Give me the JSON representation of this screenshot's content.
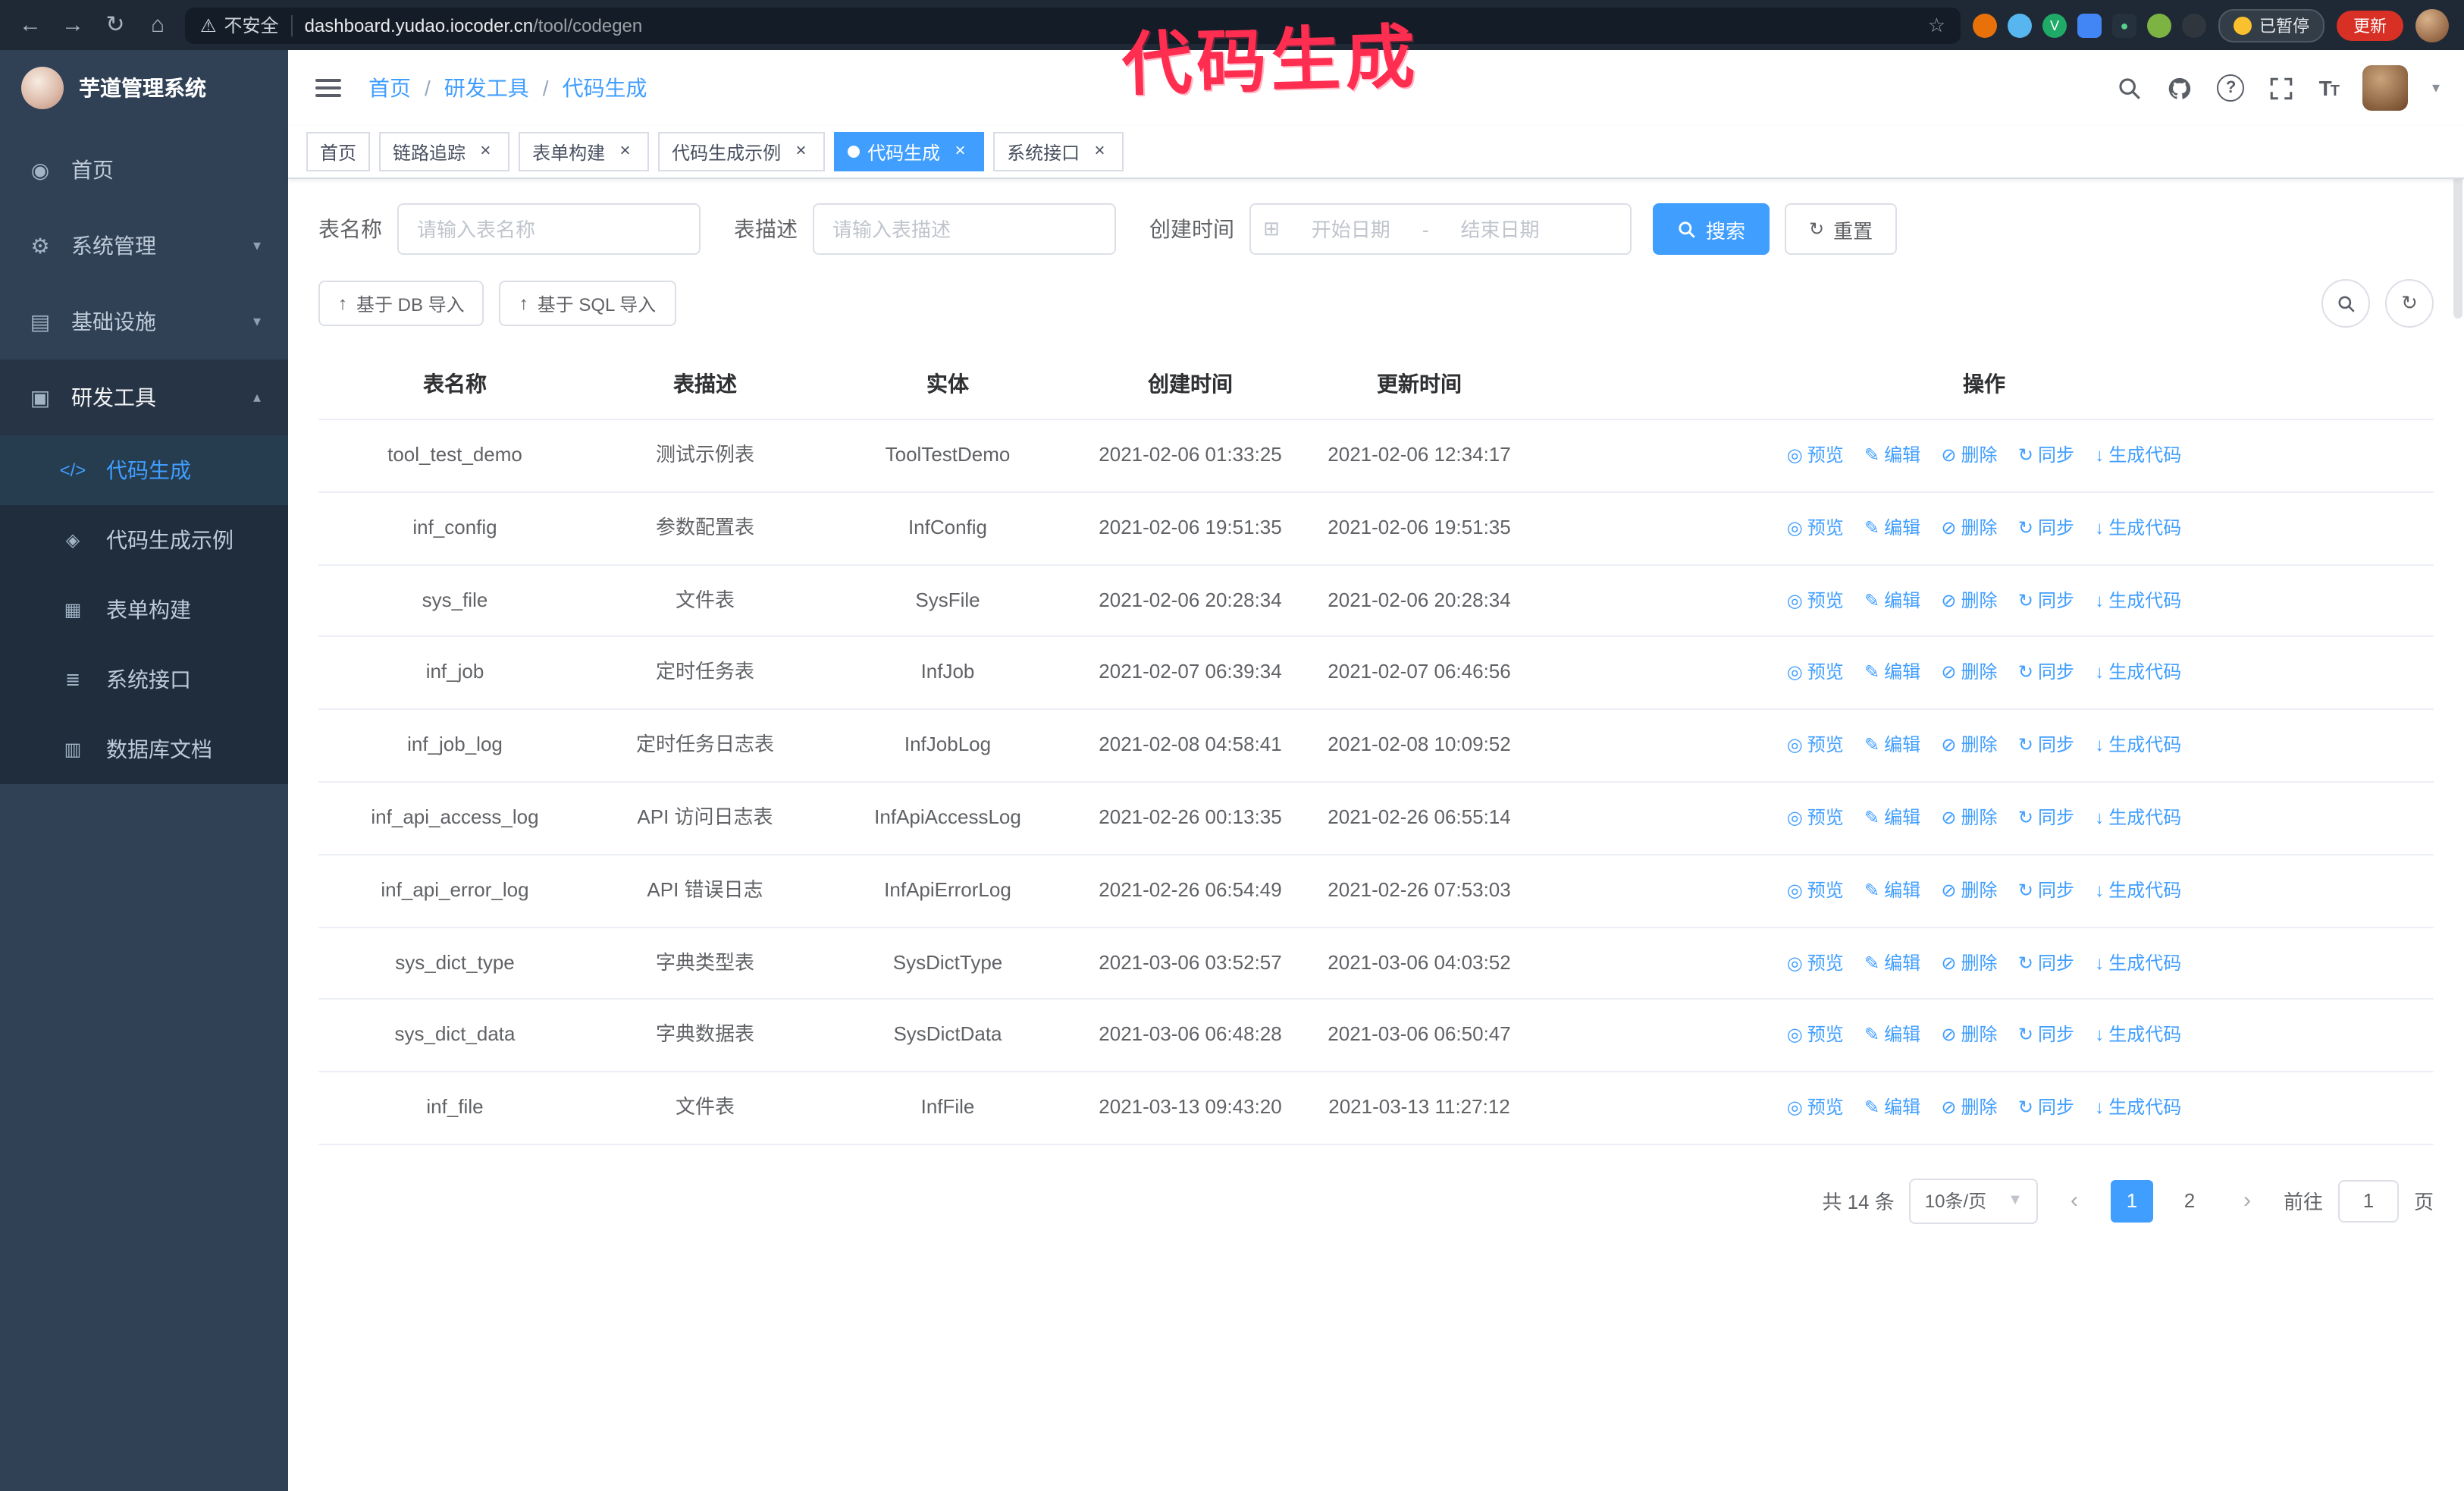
{
  "browser": {
    "security_label": "不安全",
    "url_host": "dashboard.yudao.iocoder.cn",
    "url_path": "/tool/codegen",
    "paused_label": "已暂停",
    "update_label": "更新"
  },
  "annotation": {
    "text": "代码生成",
    "color": "#ff2d4f"
  },
  "icons": {
    "back": "←",
    "forward": "→",
    "reload": "↻",
    "home": "⌂",
    "warning": "⚠",
    "star": "☆",
    "caret_down": "▾",
    "caret_up": "▴",
    "upload": "↑",
    "calendar": "⊞",
    "eye": "◎",
    "edit": "✎",
    "trash": "⊘",
    "sync": "↻",
    "download": "↓",
    "close": "×",
    "prev": "‹",
    "next": "›",
    "select_caret": "▼"
  },
  "sidebar": {
    "logo_title": "芋道管理系统",
    "items": [
      {
        "label": "首页",
        "icon": "◉"
      },
      {
        "label": "系统管理",
        "icon": "⚙"
      },
      {
        "label": "基础设施",
        "icon": "▤"
      },
      {
        "label": "研发工具",
        "icon": "▣"
      }
    ],
    "sub_items": [
      {
        "label": "代码生成",
        "icon": "</>",
        "active": true
      },
      {
        "label": "代码生成示例",
        "icon": "◈"
      },
      {
        "label": "表单构建",
        "icon": "▦"
      },
      {
        "label": "系统接口",
        "icon": "≣"
      },
      {
        "label": "数据库文档",
        "icon": "▥"
      }
    ]
  },
  "header": {
    "breadcrumb": [
      "首页",
      "研发工具",
      "代码生成"
    ]
  },
  "tabs": [
    {
      "label": "首页",
      "closable": false
    },
    {
      "label": "链路追踪",
      "closable": true
    },
    {
      "label": "表单构建",
      "closable": true
    },
    {
      "label": "代码生成示例",
      "closable": true
    },
    {
      "label": "代码生成",
      "closable": true,
      "active": true
    },
    {
      "label": "系统接口",
      "closable": true
    }
  ],
  "filters": {
    "table_name_label": "表名称",
    "table_name_placeholder": "请输入表名称",
    "table_desc_label": "表描述",
    "table_desc_placeholder": "请输入表描述",
    "create_time_label": "创建时间",
    "date_start_placeholder": "开始日期",
    "date_separator": "-",
    "date_end_placeholder": "结束日期",
    "search_label": "搜索",
    "reset_label": "重置"
  },
  "toolbar": {
    "import_db_label": "基于 DB 导入",
    "import_sql_label": "基于 SQL 导入"
  },
  "table": {
    "columns": [
      "表名称",
      "表描述",
      "实体",
      "创建时间",
      "更新时间",
      "操作"
    ],
    "actions": [
      "预览",
      "编辑",
      "删除",
      "同步",
      "生成代码"
    ],
    "rows": [
      {
        "name": "tool_test_demo",
        "desc": "测试示例表",
        "entity": "ToolTestDemo",
        "created": "2021-02-06 01:33:25",
        "updated": "2021-02-06 12:34:17"
      },
      {
        "name": "inf_config",
        "desc": "参数配置表",
        "entity": "InfConfig",
        "created": "2021-02-06 19:51:35",
        "updated": "2021-02-06 19:51:35"
      },
      {
        "name": "sys_file",
        "desc": "文件表",
        "entity": "SysFile",
        "created": "2021-02-06 20:28:34",
        "updated": "2021-02-06 20:28:34"
      },
      {
        "name": "inf_job",
        "desc": "定时任务表",
        "entity": "InfJob",
        "created": "2021-02-07 06:39:34",
        "updated": "2021-02-07 06:46:56"
      },
      {
        "name": "inf_job_log",
        "desc": "定时任务日志表",
        "entity": "InfJobLog",
        "created": "2021-02-08 04:58:41",
        "updated": "2021-02-08 10:09:52"
      },
      {
        "name": "inf_api_access_log",
        "desc": "API 访问日志表",
        "entity": "InfApiAccessLog",
        "created": "2021-02-26 00:13:35",
        "updated": "2021-02-26 06:55:14"
      },
      {
        "name": "inf_api_error_log",
        "desc": "API 错误日志",
        "entity": "InfApiErrorLog",
        "created": "2021-02-26 06:54:49",
        "updated": "2021-02-26 07:53:03"
      },
      {
        "name": "sys_dict_type",
        "desc": "字典类型表",
        "entity": "SysDictType",
        "created": "2021-03-06 03:52:57",
        "updated": "2021-03-06 04:03:52"
      },
      {
        "name": "sys_dict_data",
        "desc": "字典数据表",
        "entity": "SysDictData",
        "created": "2021-03-06 06:48:28",
        "updated": "2021-03-06 06:50:47"
      },
      {
        "name": "inf_file",
        "desc": "文件表",
        "entity": "InfFile",
        "created": "2021-03-13 09:43:20",
        "updated": "2021-03-13 11:27:12"
      }
    ]
  },
  "pagination": {
    "total_label": "共 14 条",
    "page_size": "10条/页",
    "pages": [
      "1",
      "2"
    ],
    "goto_label": "前往",
    "goto_value": "1",
    "page_label": "页"
  }
}
